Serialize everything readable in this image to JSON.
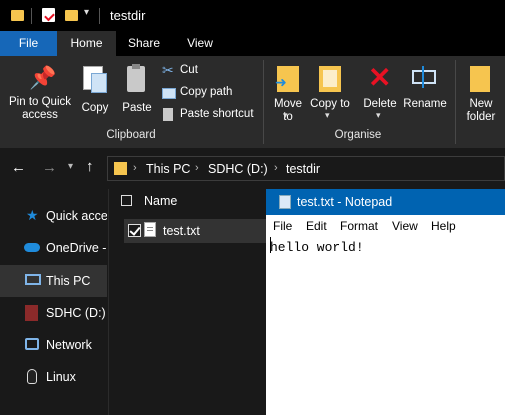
{
  "window": {
    "title": "testdir"
  },
  "ribbon_tabs": [
    "File",
    "Home",
    "Share",
    "View"
  ],
  "clipboard": {
    "pin_label": "Pin to Quick access",
    "copy_label": "Copy",
    "paste_label": "Paste",
    "cut_label": "Cut",
    "copy_path_label": "Copy path",
    "paste_shortcut_label": "Paste shortcut",
    "group_label": "Clipboard"
  },
  "organise": {
    "move_label": "Move to",
    "copy_to_label": "Copy to",
    "delete_label": "Delete",
    "rename_label": "Rename",
    "group_label": "Organise"
  },
  "new": {
    "new_folder_label": "New folder"
  },
  "breadcrumb": [
    "This PC",
    "SDHC (D:)",
    "testdir"
  ],
  "nav_items": [
    "Quick access",
    "OneDrive -",
    "This PC",
    "SDHC (D:)",
    "Network",
    "Linux"
  ],
  "file_list": {
    "header": "Name",
    "files": [
      "test.txt"
    ]
  },
  "notepad": {
    "title": "test.txt - Notepad",
    "menu": [
      "File",
      "Edit",
      "Format",
      "View",
      "Help"
    ],
    "content": "hello world!"
  },
  "colors": {
    "accent": "#0063b1",
    "file_tab": "#1667b8",
    "delete_red": "#e81123",
    "folder_yellow": "#f6c54f"
  }
}
